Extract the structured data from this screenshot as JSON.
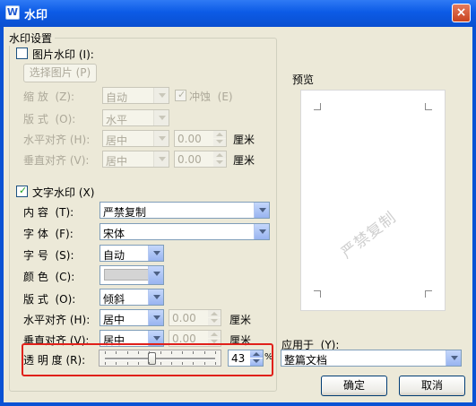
{
  "window": {
    "title": "水印",
    "close_glyph": "×",
    "app_icon_glyph": "W"
  },
  "settings_group": {
    "title": "水印设置"
  },
  "picture": {
    "checkbox_label": "图片水印",
    "checkbox_key": "(I):",
    "checked": false,
    "select_button": "选择图片",
    "select_key": "(P)",
    "zoom_label": "缩 放",
    "zoom_key": "(Z):",
    "zoom_value": "自动",
    "washout_label": "冲蚀",
    "washout_key": "(E)",
    "washout_checked": true,
    "layout_label": "版 式",
    "layout_key": "(O):",
    "layout_value": "水平",
    "halign_label": "水平对齐",
    "halign_key": "(H):",
    "halign_value": "居中",
    "halign_offset": "0.00",
    "valign_label": "垂直对齐",
    "valign_key": "(V):",
    "valign_value": "居中",
    "valign_offset": "0.00",
    "unit": "厘米"
  },
  "text": {
    "checkbox_label": "文字水印",
    "checkbox_key": "(X)",
    "checked": true,
    "content_label": "内 容",
    "content_key": "(T):",
    "content_value": "严禁复制",
    "font_label": "字 体",
    "font_key": "(F):",
    "font_value": "宋体",
    "size_label": "字 号",
    "size_key": "(S):",
    "size_value": "自动",
    "color_label": "颜 色",
    "color_key": "(C):",
    "color_value": "#d4d4d4",
    "layout_label": "版 式",
    "layout_key": "(O):",
    "layout_value": "倾斜",
    "halign_label": "水平对齐",
    "halign_key": "(H):",
    "halign_value": "居中",
    "halign_offset": "0.00",
    "valign_label": "垂直对齐",
    "valign_key": "(V):",
    "valign_value": "居中",
    "valign_offset": "0.00",
    "unit": "厘米",
    "transparency_label": "透 明 度",
    "transparency_key": "(R):",
    "transparency_value": "43",
    "transparency_unit": "%",
    "transparency_fraction": 0.43
  },
  "preview": {
    "title": "预览",
    "watermark_text": "严禁复制"
  },
  "apply": {
    "label": "应用于",
    "key": "(Y):",
    "value": "整篇文档"
  },
  "buttons": {
    "ok": "确定",
    "cancel": "取消"
  },
  "colors": {
    "title_bar": "#0c5be6",
    "dialog_bg": "#ece9d8",
    "highlight": "#e0201a"
  }
}
